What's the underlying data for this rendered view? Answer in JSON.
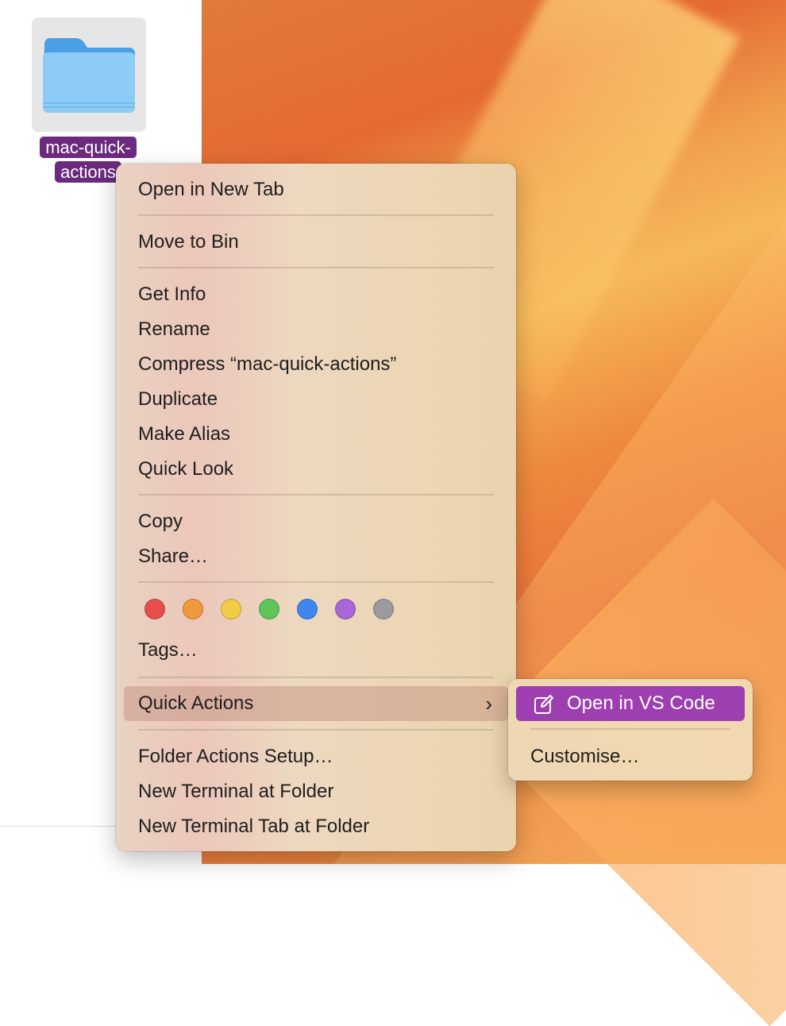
{
  "folder": {
    "name_line1": "mac-quick-",
    "name_line2": "actions"
  },
  "context_menu": {
    "open_new_tab": "Open in New Tab",
    "move_to_bin": "Move to Bin",
    "get_info": "Get Info",
    "rename": "Rename",
    "compress": "Compress “mac-quick-actions”",
    "duplicate": "Duplicate",
    "make_alias": "Make Alias",
    "quick_look": "Quick Look",
    "copy": "Copy",
    "share": "Share…",
    "tags": "Tags…",
    "quick_actions": "Quick Actions",
    "folder_actions_setup": "Folder Actions Setup…",
    "new_terminal": "New Terminal at Folder",
    "new_terminal_tab": "New Terminal Tab at Folder",
    "tag_colors": [
      "#e6504a",
      "#ef9a3a",
      "#f2cc45",
      "#5ec55a",
      "#3f86f0",
      "#a966d8",
      "#9b9b9e"
    ]
  },
  "submenu": {
    "open_vscode": "Open in VS Code",
    "customise": "Customise…"
  },
  "colors": {
    "highlight_purple": "#9d3fb0",
    "selection_label": "#6b2a7e"
  }
}
